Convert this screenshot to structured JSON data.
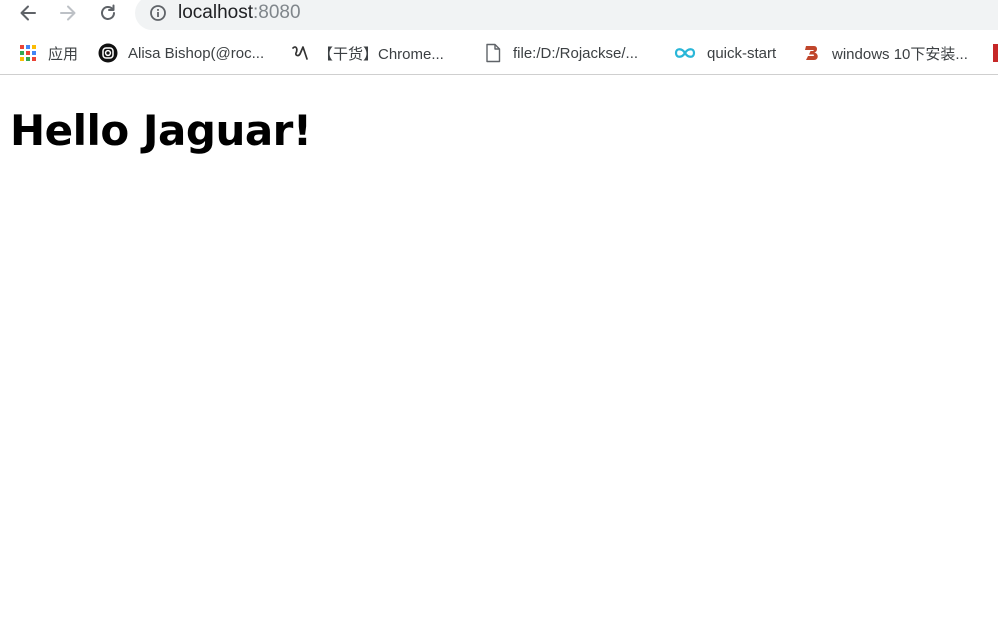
{
  "browser": {
    "address_bar": {
      "host": "localhost",
      "port": ":8080"
    }
  },
  "bookmarks": [
    {
      "icon": "apps-grid-icon",
      "label": "应用"
    },
    {
      "icon": "instagram-icon",
      "label": "Alisa Bishop(@roc..."
    },
    {
      "icon": "bookmark-favicon-icon",
      "label": "【干货】Chrome..."
    },
    {
      "icon": "file-icon",
      "label": "file:/D:/Rojackse/..."
    },
    {
      "icon": "infinity-icon",
      "label": "quick-start"
    },
    {
      "icon": "b-logo-icon",
      "label": "windows 10下安装..."
    }
  ],
  "page": {
    "heading": "Hello Jaguar!"
  },
  "colors": {
    "infinity_icon": "#29b6d8",
    "b_logo": "#c0452b",
    "overflow_bookmark": "#c62828"
  }
}
